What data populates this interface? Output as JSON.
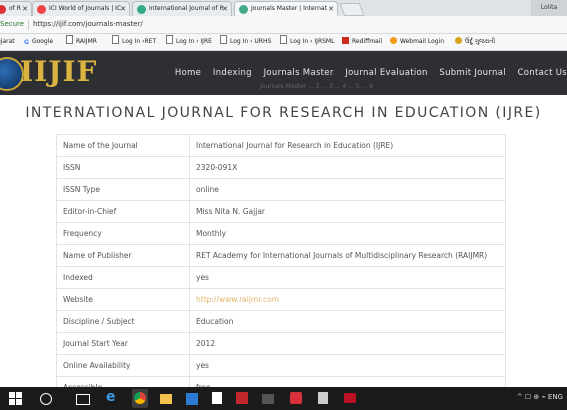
{
  "browser": {
    "tabs": [
      {
        "label": "of R",
        "fav_color": "#d33"
      },
      {
        "label": "ICI World of Journals | IC",
        "fav_color": "#e44"
      },
      {
        "label": "International Journal of R",
        "fav_color": "#3a8"
      },
      {
        "label": "Journals Master | Internat",
        "fav_color": "#4a8",
        "active": true
      }
    ],
    "window_control": "Lolita",
    "secure_label": "Secure",
    "url": "https://ijif.com/journals-master/"
  },
  "bookmarks": [
    {
      "label": "ujarat",
      "icon": "none"
    },
    {
      "label": "Google",
      "icon": "google-g"
    },
    {
      "label": "RAIJMR",
      "icon": "page"
    },
    {
      "label": "Log In ‹RET",
      "icon": "page"
    },
    {
      "label": "Log In ‹ IJRE",
      "icon": "page"
    },
    {
      "label": "Log In ‹ URHS",
      "icon": "page"
    },
    {
      "label": "Log In ‹ IJRSML",
      "icon": "page"
    },
    {
      "label": "Rediffmail",
      "icon": "red"
    },
    {
      "label": "Webmail Login",
      "icon": "orange"
    },
    {
      "label": "ઉર્દૂ ગુજરાતી",
      "icon": "gold"
    }
  ],
  "site": {
    "logo_text": "IIJIF",
    "nav": [
      "Home",
      "Indexing",
      "Journals Master",
      "Journal Evaluation",
      "Submit Journal",
      "Contact Us"
    ],
    "faded_text": "Journals Master ... 2 ... 3 ... 4 ... 5 ... 6"
  },
  "journal": {
    "title": "INTERNATIONAL JOURNAL FOR RESEARCH IN EDUCATION (IJRE)",
    "rows": [
      {
        "key": "Name of the Journal",
        "value": "International Journal for Research in Education (IJRE)"
      },
      {
        "key": "ISSN",
        "value": "2320-091X"
      },
      {
        "key": "ISSN Type",
        "value": "online"
      },
      {
        "key": "Editor-in-Chief",
        "value": "Miss Nita N. Gajjar"
      },
      {
        "key": "Frequency",
        "value": "Monthly"
      },
      {
        "key": "Name of Publisher",
        "value": "RET Academy for International Journals of Multidisciplinary Research (RAIJMR)"
      },
      {
        "key": "Indexed",
        "value": "yes"
      },
      {
        "key": "Website",
        "value": "http://www.raijmr.com",
        "link": true
      },
      {
        "key": "Discipline / Subject",
        "value": "Education"
      },
      {
        "key": "Journal Start Year",
        "value": "2012"
      },
      {
        "key": "Online Availability",
        "value": "yes"
      },
      {
        "key": "Accessible",
        "value": "free"
      }
    ]
  },
  "taskbar": {
    "apps": [
      "search-circle",
      "task-view",
      "edge",
      "chrome",
      "file-explorer",
      "store",
      "pdf",
      "acrobat",
      "movie",
      "music",
      "calculator",
      "app"
    ],
    "tray_text": "^ ☐ ⊕ ⌁ ENG"
  }
}
